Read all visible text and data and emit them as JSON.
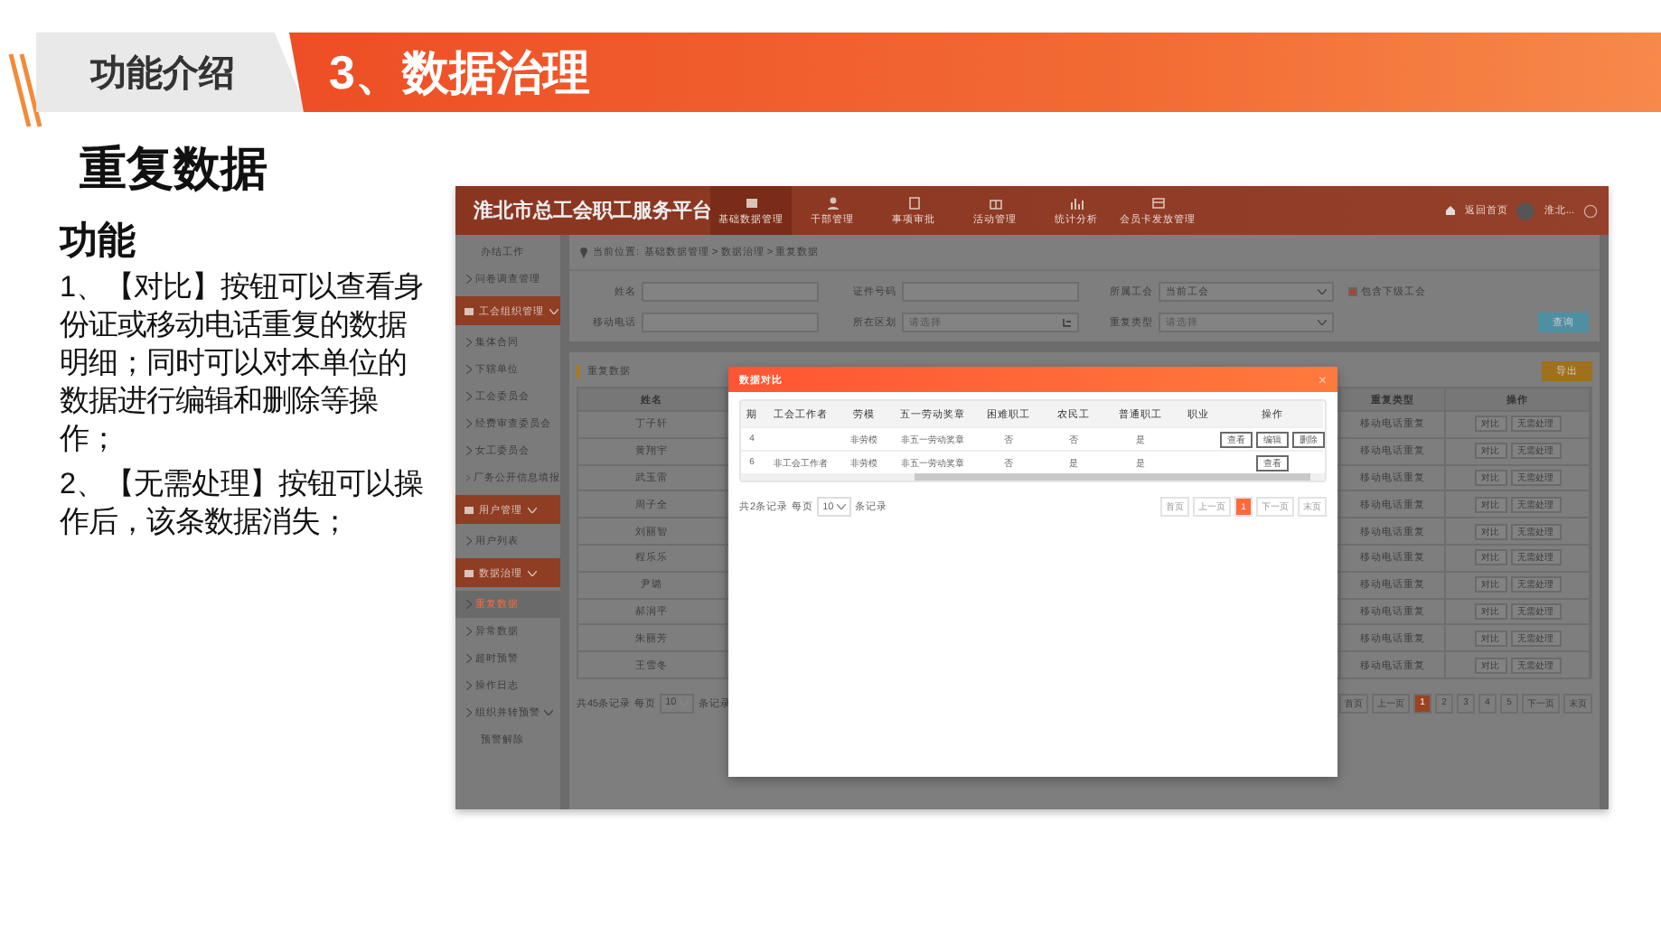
{
  "slide": {
    "section_tab": "功能介绍",
    "title": "3、数据治理",
    "heading": "重复数据",
    "subheading": "功能",
    "paragraphs": [
      "1、【对比】按钮可以查看身份证或移动电话重复的数据明细；同时可以对本单位的数据进行编辑和删除等操作；",
      "2、【无需处理】按钮可以操作后，该条数据消失；"
    ]
  },
  "app": {
    "brand": "淮北市总工会职工服务平台",
    "nav": [
      {
        "label": "基础数据管理",
        "selected": true
      },
      {
        "label": "干部管理",
        "selected": false
      },
      {
        "label": "事项审批",
        "selected": false
      },
      {
        "label": "活动管理",
        "selected": false
      },
      {
        "label": "统计分析",
        "selected": false
      },
      {
        "label": "会员卡发放管理",
        "selected": false
      }
    ],
    "home_link": "返回首页",
    "user_name": "淮北...",
    "sidebar": [
      {
        "kind": "plain",
        "label": "办结工作",
        "selected": false
      },
      {
        "kind": "item",
        "label": "问卷调查管理",
        "selected": false
      },
      {
        "kind": "group",
        "label": "工会组织管理",
        "expanded": true
      },
      {
        "kind": "item",
        "label": "集体合同",
        "selected": false
      },
      {
        "kind": "item",
        "label": "下辖单位",
        "selected": false
      },
      {
        "kind": "item",
        "label": "工会委员会",
        "selected": false
      },
      {
        "kind": "item",
        "label": "经费审查委员会",
        "selected": false
      },
      {
        "kind": "item",
        "label": "女工委员会",
        "selected": false
      },
      {
        "kind": "item",
        "label": "厂务公开信息填报",
        "selected": false
      },
      {
        "kind": "group",
        "label": "用户管理",
        "expanded": true
      },
      {
        "kind": "item",
        "label": "用户列表",
        "selected": false
      },
      {
        "kind": "group",
        "label": "数据治理",
        "expanded": true
      },
      {
        "kind": "item",
        "label": "重复数据",
        "selected": true
      },
      {
        "kind": "item",
        "label": "异常数据",
        "selected": false
      },
      {
        "kind": "item",
        "label": "超时预警",
        "selected": false
      },
      {
        "kind": "item",
        "label": "操作日志",
        "selected": false
      },
      {
        "kind": "item",
        "label": "组织并转预警",
        "selected": false,
        "expanded": true
      },
      {
        "kind": "plain",
        "label": "预警解除",
        "selected": false
      }
    ],
    "breadcrumb": {
      "label": "当前位置:",
      "path": "基础数据管理 > 数据治理 > 重复数据"
    },
    "filters": [
      {
        "kind": "input",
        "label": "姓名"
      },
      {
        "kind": "input",
        "label": "证件号码"
      },
      {
        "kind": "select",
        "label": "所属工会",
        "value": "当前工会"
      },
      {
        "kind": "input",
        "label": "移动电话"
      },
      {
        "kind": "picker",
        "label": "所在区划",
        "placeholder": "请选择"
      },
      {
        "kind": "select",
        "label": "重复类型",
        "placeholder": "请选择"
      }
    ],
    "include_sub": {
      "label": "包含下级工会",
      "checked": true
    },
    "search_button": "查询",
    "section_title": "重复数据",
    "export_button": "导出",
    "table": {
      "columns": [
        "姓名",
        "重复类型",
        "操作"
      ],
      "rows": [
        {
          "name": "丁子轩",
          "type": "移动电话重复",
          "actions": [
            "对比",
            "无需处理"
          ]
        },
        {
          "name": "黄翔宇",
          "type": "移动电话重复",
          "actions": [
            "对比",
            "无需处理"
          ]
        },
        {
          "name": "武玉雷",
          "type": "移动电话重复",
          "actions": [
            "对比",
            "无需处理"
          ]
        },
        {
          "name": "周子全",
          "type": "移动电话重复",
          "actions": [
            "对比",
            "无需处理"
          ]
        },
        {
          "name": "刘丽智",
          "type": "移动电话重复",
          "actions": [
            "对比",
            "无需处理"
          ]
        },
        {
          "name": "程乐乐",
          "type": "移动电话重复",
          "actions": [
            "对比",
            "无需处理"
          ]
        },
        {
          "name": "尹璐",
          "type": "移动电话重复",
          "actions": [
            "对比",
            "无需处理"
          ]
        },
        {
          "name": "郝润平",
          "type": "移动电话重复",
          "actions": [
            "对比",
            "无需处理"
          ]
        },
        {
          "name": "朱丽芳",
          "type": "移动电话重复",
          "actions": [
            "对比",
            "无需处理"
          ]
        },
        {
          "name": "王雪冬",
          "type": "移动电话重复",
          "actions": [
            "对比",
            "无需处理"
          ]
        }
      ]
    },
    "pagination": {
      "total": "共45条记录",
      "per_page_label": "每页",
      "per_page": "10",
      "per_page_suffix": "条记录",
      "pages": [
        {
          "label": "首页",
          "selected": false
        },
        {
          "label": "上一页",
          "selected": false
        },
        {
          "label": "1",
          "selected": true
        },
        {
          "label": "2",
          "selected": false
        },
        {
          "label": "3",
          "selected": false
        },
        {
          "label": "4",
          "selected": false
        },
        {
          "label": "5",
          "selected": false
        },
        {
          "label": "下一页",
          "selected": false
        },
        {
          "label": "末页",
          "selected": false
        }
      ]
    },
    "dialog": {
      "title": "数据对比",
      "close": "×",
      "columns": [
        "期",
        "工会工作者",
        "劳模",
        "五一劳动奖章",
        "困难职工",
        "农民工",
        "普通职工",
        "职业",
        "操作"
      ],
      "rows": [
        {
          "cells": [
            "4",
            "",
            "非劳模",
            "非五一劳动奖章",
            "否",
            "否",
            "是",
            ""
          ],
          "actions": [
            "查看",
            "编辑",
            "删除"
          ]
        },
        {
          "cells": [
            "6",
            "非工会工作者",
            "非劳模",
            "非五一劳动奖章",
            "否",
            "是",
            "是",
            ""
          ],
          "actions": [
            "查看"
          ]
        }
      ],
      "pagination": {
        "total": "共2条记录",
        "per_page_label": "每页",
        "per_page": "10",
        "per_page_suffix": "条记录",
        "pages": [
          {
            "label": "首页",
            "selected": false
          },
          {
            "label": "上一页",
            "selected": false
          },
          {
            "label": "1",
            "selected": true
          },
          {
            "label": "下一页",
            "selected": false
          },
          {
            "label": "末页",
            "selected": false
          }
        ]
      }
    }
  }
}
